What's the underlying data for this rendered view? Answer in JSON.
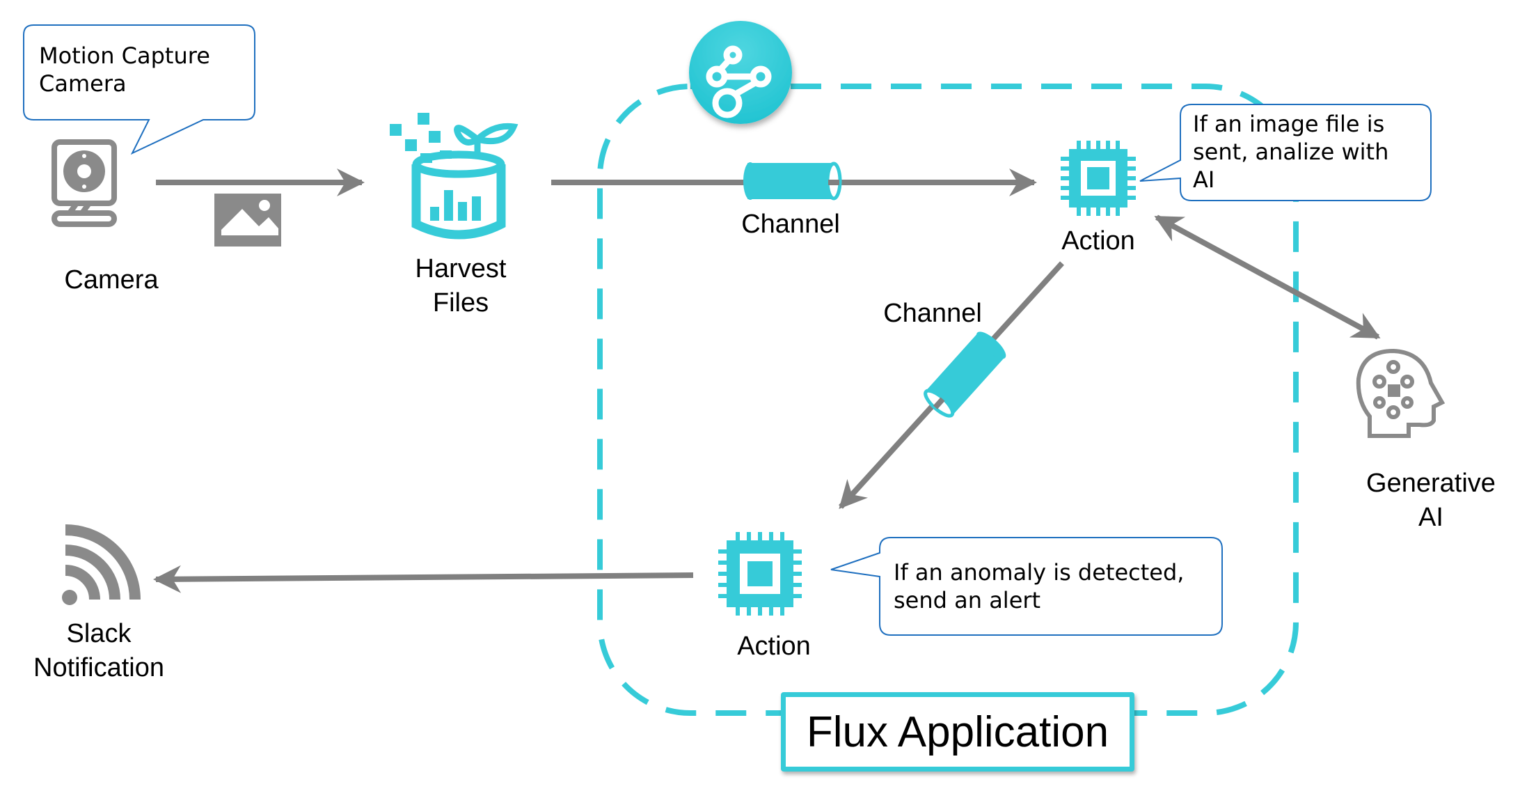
{
  "colors": {
    "accent": "#36cbd8",
    "arrow": "#808080",
    "icon_gray": "#8a8a8a",
    "callout_border": "#1e6fbf",
    "text": "#000000"
  },
  "nodes": {
    "camera": {
      "label": "Camera",
      "icon": "webcam-icon"
    },
    "harvest": {
      "label": "Harvest\nFiles",
      "icon": "harvest-files-icon"
    },
    "action_top": {
      "label": "Action",
      "icon": "chip-icon"
    },
    "action_bottom": {
      "label": "Action",
      "icon": "chip-icon"
    },
    "generative_ai": {
      "label": "Generative\nAI",
      "icon": "ai-head-icon"
    },
    "slack": {
      "label": "Slack\nNotification",
      "icon": "broadcast-icon"
    }
  },
  "channels": {
    "top": {
      "label": "Channel",
      "icon": "pipe-icon"
    },
    "diagonal": {
      "label": "Channel",
      "icon": "pipe-icon"
    }
  },
  "callouts": {
    "camera": "Motion Capture\nCamera",
    "action_top": "If an image file is\nsent, analize with\nAI",
    "action_bottom": "If an anomaly is detected,\nsend an alert"
  },
  "flux": {
    "title": "Flux Application",
    "icon": "flow-graph-icon"
  },
  "payload_icon": "image-icon"
}
